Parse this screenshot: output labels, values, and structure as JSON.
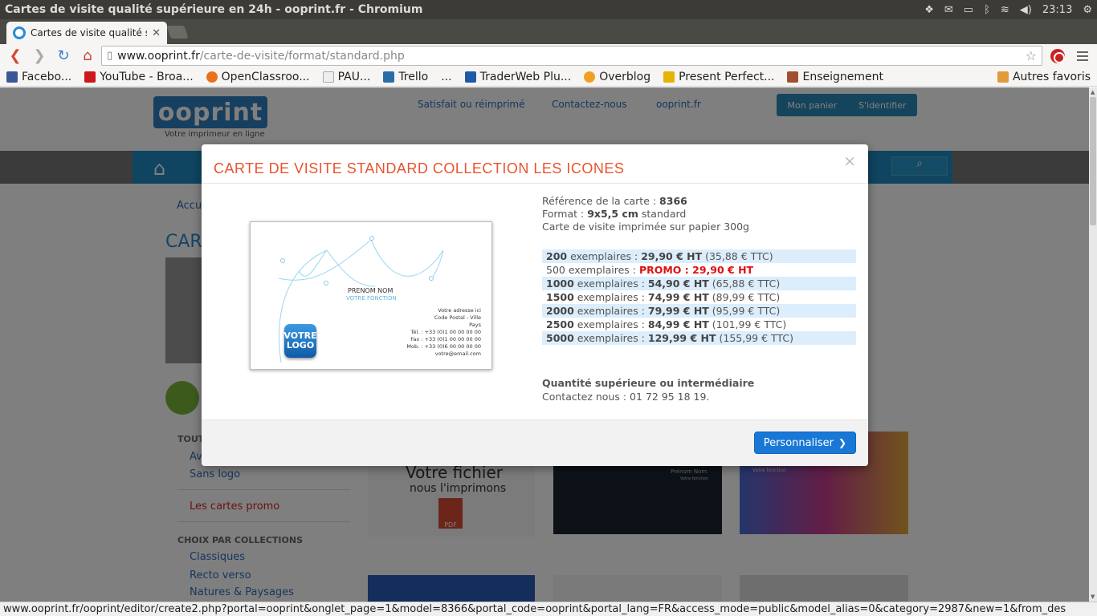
{
  "os": {
    "window_title": "Cartes de visite qualité supérieure en 24h - ooprint.fr - Chromium",
    "clock": "23:13"
  },
  "browser": {
    "tab_title": "Cartes de visite qualité su",
    "url_host": "www.ooprint.fr",
    "url_path": "/carte-de-visite/format/standard.php",
    "ext_badge": "5",
    "bookmarks": [
      {
        "label": "Facebo...",
        "color": "#3b5998"
      },
      {
        "label": "YouTube - Broa...",
        "color": "#cc181e"
      },
      {
        "label": "OpenClassroo...",
        "color": "#e8731c"
      },
      {
        "label": "PAU...",
        "color": "#cccccc"
      },
      {
        "label": "Trello",
        "color": "#2a6ea8"
      },
      {
        "label": "...",
        "color": ""
      },
      {
        "label": "TraderWeb Plu...",
        "color": "#1f5aa8"
      },
      {
        "label": "Overblog",
        "color": "#f0a020"
      },
      {
        "label": "Present Perfect...",
        "color": "#e6b400"
      },
      {
        "label": "Enseignement",
        "color": "#a05030"
      }
    ],
    "other_bookmarks": "Autres favoris",
    "status_url": "www.ooprint.fr/ooprint/editor/create2.php?portal=ooprint&onglet_page=1&model=8366&portal_code=ooprint&portal_lang=FR&access_mode=public&model_alias=0&category=2987&new=1&from_des"
  },
  "site": {
    "logo": "ooprint",
    "tagline": "Votre imprimeur en ligne",
    "header_links": [
      "Satisfait ou réimprimé",
      "Contactez-nous",
      "ooprint.fr"
    ],
    "cart": "Mon panier",
    "login": "S'identifier",
    "breadcrumb": "Accu",
    "page_title": "CAR",
    "side_heading_all": "TOUT",
    "side_links": [
      "Av",
      "Sans logo"
    ],
    "side_promo": "Les cartes promo",
    "side_heading_collections": "CHOIX PAR COLLECTIONS",
    "collections": [
      "Classiques",
      "Recto verso",
      "Natures & Paysages"
    ],
    "thumb_file_title": "Votre fichier",
    "thumb_file_sub": "nous l'imprimons",
    "thumb_card_name": "Prénom Nom",
    "thumb_card_func": "Votre fonction"
  },
  "modal": {
    "title": "CARTE DE VISITE STANDARD COLLECTION LES ICONES",
    "close": "×",
    "ref_label": "Référence de la carte : ",
    "ref_value": "8366",
    "format_label": "Format : ",
    "format_value": "9x5,5 cm",
    "format_suffix": " standard",
    "paper": "Carte de visite imprimée sur papier 300g",
    "prices": [
      {
        "qty": "200",
        "label": " exemplaires : ",
        "ht": "29,90 € HT",
        "ttc": " (35,88 € TTC)",
        "promo": ""
      },
      {
        "qty": "500",
        "label": " exemplaires : ",
        "ht": "",
        "ttc": "",
        "promo": "PROMO : 29,90 € HT"
      },
      {
        "qty": "1000",
        "label": " exemplaires : ",
        "ht": "54,90 € HT",
        "ttc": " (65,88 € TTC)",
        "promo": ""
      },
      {
        "qty": "1500",
        "label": " exemplaires : ",
        "ht": "74,99 € HT",
        "ttc": " (89,99 € TTC)",
        "promo": ""
      },
      {
        "qty": "2000",
        "label": " exemplaires : ",
        "ht": "79,99 € HT",
        "ttc": " (95,99 € TTC)",
        "promo": ""
      },
      {
        "qty": "2500",
        "label": " exemplaires : ",
        "ht": "84,99 € HT",
        "ttc": " (101,99 € TTC)",
        "promo": ""
      },
      {
        "qty": "5000",
        "label": " exemplaires : ",
        "ht": "129,99 € HT",
        "ttc": " (155,99 € TTC)",
        "promo": ""
      }
    ],
    "qty_title": "Quantité supérieure ou intermédiaire",
    "qty_contact": "Contactez nous : 01 72 95 18 19.",
    "button": "Personnaliser",
    "card": {
      "name": "PRENOM NOM",
      "function": "VOTRE FONCTION",
      "address_lines": [
        "Votre adresse ici",
        "Code Postal - Ville",
        "Pays",
        "Tél. : +33 (0)1 00 00 00 00",
        "Fax : +33 (0)1 00 00 00 00",
        "Mob. : +33 (0)6 00 00 00 00",
        "votre@email.com"
      ],
      "logo": "VOTRE LOGO"
    }
  }
}
